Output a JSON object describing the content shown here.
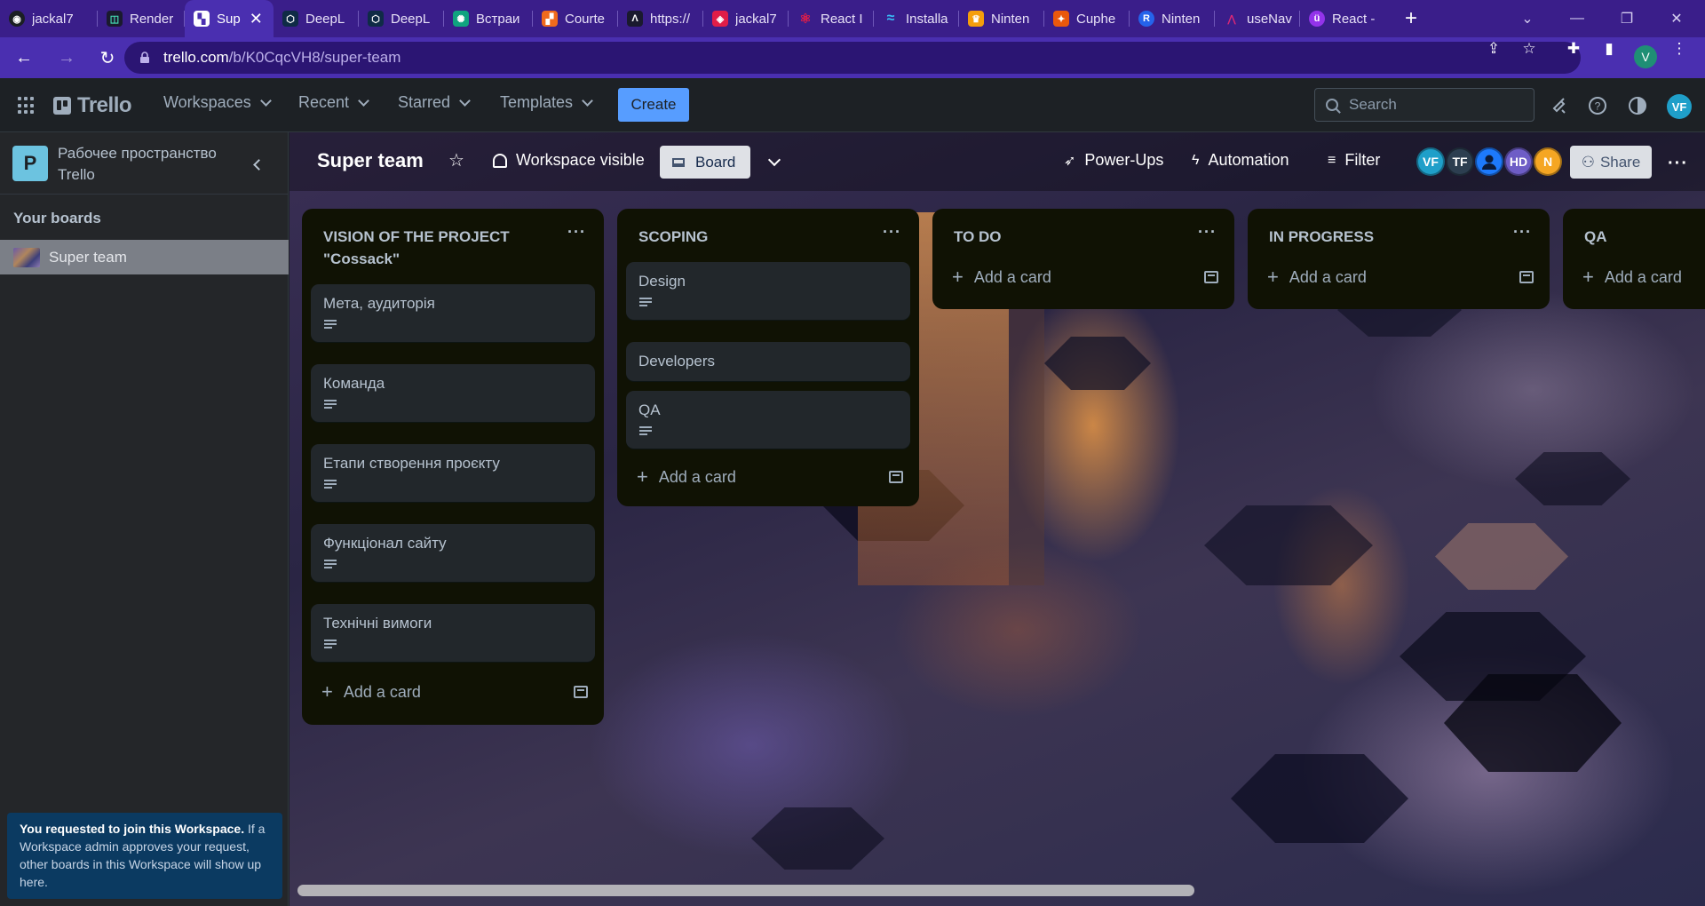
{
  "browser": {
    "tabs": [
      {
        "title": "jackal7",
        "icon_color": "#ffffff",
        "glyph": "◉",
        "active": false
      },
      {
        "title": "Render",
        "icon_color": "#46e3b7",
        "glyph": "◫",
        "active": false
      },
      {
        "title": "Sup",
        "icon_color": "#ffffff",
        "glyph": "▚",
        "active": true
      },
      {
        "title": "DeepL",
        "icon_color": "#0f2b46",
        "glyph": "⬡",
        "active": false
      },
      {
        "title": "DeepL",
        "icon_color": "#0f2b46",
        "glyph": "⬡",
        "active": false
      },
      {
        "title": "Встраи",
        "icon_color": "#10a37f",
        "glyph": "✺",
        "active": false
      },
      {
        "title": "Courte",
        "icon_color": "#f06a1d",
        "glyph": "▞",
        "active": false
      },
      {
        "title": "https://",
        "icon_color": "#1a1a2e",
        "glyph": "Λ",
        "active": false
      },
      {
        "title": "jackal7",
        "icon_color": "#e11d48",
        "glyph": "◈",
        "active": false
      },
      {
        "title": "React I",
        "icon_color": "#61dafb",
        "glyph": "⚛",
        "active": false
      },
      {
        "title": "Installa",
        "icon_color": "#38bdf8",
        "glyph": "≈",
        "active": false
      },
      {
        "title": "Ninten",
        "icon_color": "#f59e0b",
        "glyph": "♛",
        "active": false
      },
      {
        "title": "Cuphe",
        "icon_color": "#ea580c",
        "glyph": "✦",
        "active": false
      },
      {
        "title": "Ninten",
        "icon_color": "#2563eb",
        "glyph": "R",
        "active": false
      },
      {
        "title": "useNav",
        "icon_color": "#db2777",
        "glyph": "⋀",
        "active": false
      },
      {
        "title": "React -",
        "icon_color": "#9333ea",
        "glyph": "ü",
        "active": false
      }
    ],
    "new_tab": "+",
    "url_host": "trello.com",
    "url_path": "/b/K0CqcVH8/super-team",
    "profile_initial": "V"
  },
  "header": {
    "logo": "Trello",
    "nav": [
      "Workspaces",
      "Recent",
      "Starred",
      "Templates"
    ],
    "create": "Create",
    "search_placeholder": "Search",
    "avatar": "VF"
  },
  "sidebar": {
    "workspace_initial": "P",
    "workspace_name": "Рабочее пространство Trello",
    "section": "Your boards",
    "boards": [
      "Super team"
    ],
    "notice_bold": "You requested to join this Workspace.",
    "notice_rest": " If a Workspace admin approves your request, other boards in this Workspace will show up here."
  },
  "board": {
    "title": "Super team",
    "visibility": "Workspace visible",
    "view": "Board",
    "power_ups": "Power-Ups",
    "automation": "Automation",
    "filter": "Filter",
    "share": "Share",
    "members": [
      {
        "initials": "VF",
        "color": "#1f9fc9"
      },
      {
        "initials": "TF",
        "color": "#2c3e50"
      },
      {
        "initials": "",
        "color": "#1d7afc"
      },
      {
        "initials": "HD",
        "color": "#6e5dc6"
      },
      {
        "initials": "N",
        "color": "#f5a623"
      }
    ]
  },
  "lists": [
    {
      "title": "VISION OF THE PROJECT \"Cossack\"",
      "cards": [
        "Мета, аудиторія",
        "Команда",
        "Етапи створення проєкту",
        "Функціонал сайту",
        "Технічні вимоги"
      ],
      "add": "Add a card"
    },
    {
      "title": "SCOPING",
      "cards": [
        "Design",
        "Developers",
        "QA"
      ],
      "add": "Add a card"
    },
    {
      "title": "TO DO",
      "cards": [],
      "add": "Add a card"
    },
    {
      "title": "IN PROGRESS",
      "cards": [],
      "add": "Add a card"
    },
    {
      "title": "QA",
      "cards": [],
      "add": "Add a card"
    }
  ]
}
